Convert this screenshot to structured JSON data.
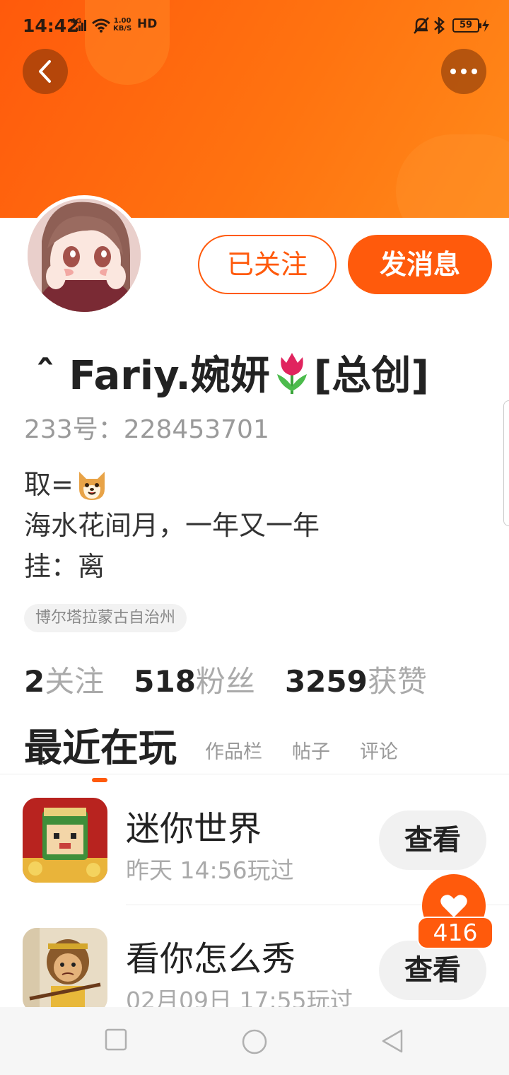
{
  "status_bar": {
    "time": "14:42",
    "network": "4G",
    "speed_top": "1.00",
    "speed_bottom": "KB/S",
    "hd": "HD",
    "battery": "59"
  },
  "profile": {
    "follow_label": "已关注",
    "message_label": "发消息",
    "nickname_prefix": "ˆ Fariy.婉妍",
    "nickname_suffix": "[总创]",
    "uid": "233号：228453701",
    "bio": {
      "line1": "取=",
      "line2": "海水花间月，一年又一年",
      "line3": "挂：离"
    },
    "location": "博尔塔拉蒙古自治州"
  },
  "stats": [
    {
      "num": "2",
      "label": "关注"
    },
    {
      "num": "518",
      "label": "粉丝"
    },
    {
      "num": "3259",
      "label": "获赞"
    }
  ],
  "tabs": {
    "active": "最近在玩",
    "others": [
      "作品栏",
      "帖子",
      "评论"
    ]
  },
  "games": [
    {
      "name": "迷你世界",
      "time": "昨天 14:56玩过",
      "action": "查看"
    },
    {
      "name": "看你怎么秀",
      "time": "02月09日 17:55玩过",
      "action": "查看"
    }
  ],
  "like_badge": "416",
  "icons": {
    "back": "back-arrow-icon",
    "more": "more-dots-icon",
    "emoji": "shiba-dog-emoji",
    "tulip": "tulip-emoji"
  },
  "colors": {
    "accent": "#ff5a0c",
    "banner": "#ff7310",
    "muted": "#aaaaaa"
  }
}
